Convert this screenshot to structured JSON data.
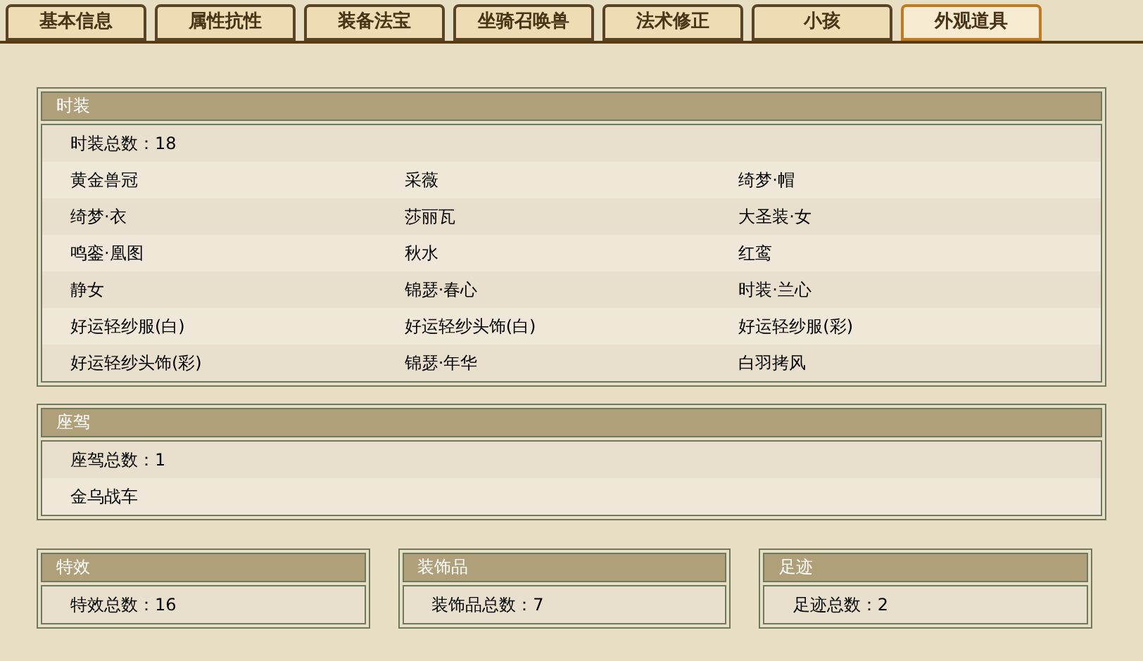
{
  "tabs": [
    {
      "label": "基本信息",
      "selected": false
    },
    {
      "label": "属性抗性",
      "selected": false
    },
    {
      "label": "装备法宝",
      "selected": false
    },
    {
      "label": "坐骑召唤兽",
      "selected": false
    },
    {
      "label": "法术修正",
      "selected": false
    },
    {
      "label": "小孩",
      "selected": false
    },
    {
      "label": "外观道具",
      "selected": true
    }
  ],
  "fashion": {
    "title": "时装",
    "count": "时装总数：18",
    "items": [
      "黄金兽冠",
      "采薇",
      "绮梦·帽",
      "绮梦·衣",
      "莎丽瓦",
      "大圣装·女",
      "鸣銮·凰图",
      "秋水",
      "红鸾",
      "静女",
      "锦瑟·春心",
      "时装·兰心",
      "好运轻纱服(白)",
      "好运轻纱头饰(白)",
      "好运轻纱服(彩)",
      "好运轻纱头饰(彩)",
      "锦瑟·年华",
      "白羽拷风"
    ]
  },
  "mount": {
    "title": "座驾",
    "count": "座驾总数：1",
    "items": [
      "金乌战车"
    ]
  },
  "small_panels": [
    {
      "title": "特效",
      "count": "特效总数：16"
    },
    {
      "title": "装饰品",
      "count": "装饰品总数：7"
    },
    {
      "title": "足迹",
      "count": "足迹总数：2"
    }
  ]
}
